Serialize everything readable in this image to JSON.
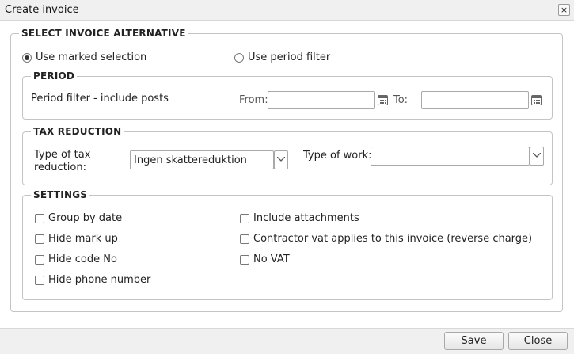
{
  "window": {
    "title": "Create invoice",
    "close_glyph": "×"
  },
  "alternative": {
    "legend": "SELECT INVOICE ALTERNATIVE",
    "option_marked": "Use marked selection",
    "option_period": "Use period filter",
    "selected": "Use marked selection"
  },
  "period": {
    "legend": "PERIOD",
    "label": "Period filter - include posts",
    "from_label": "From:",
    "from_value": "",
    "to_label": "To:",
    "to_value": ""
  },
  "tax": {
    "legend": "TAX REDUCTION",
    "type_label": "Type of tax reduction:",
    "type_value": "Ingen skattereduktion",
    "work_label": "Type of work:",
    "work_value": ""
  },
  "settings": {
    "legend": "SETTINGS",
    "group_by_date": "Group by date",
    "hide_mark_up": "Hide mark up",
    "hide_code_no": "Hide code No",
    "hide_phone": "Hide phone number",
    "include_attachments": "Include attachments",
    "contractor_vat": "Contractor vat applies to this invoice (reverse charge)",
    "no_vat": "No VAT"
  },
  "footer": {
    "save": "Save",
    "close": "Close"
  }
}
